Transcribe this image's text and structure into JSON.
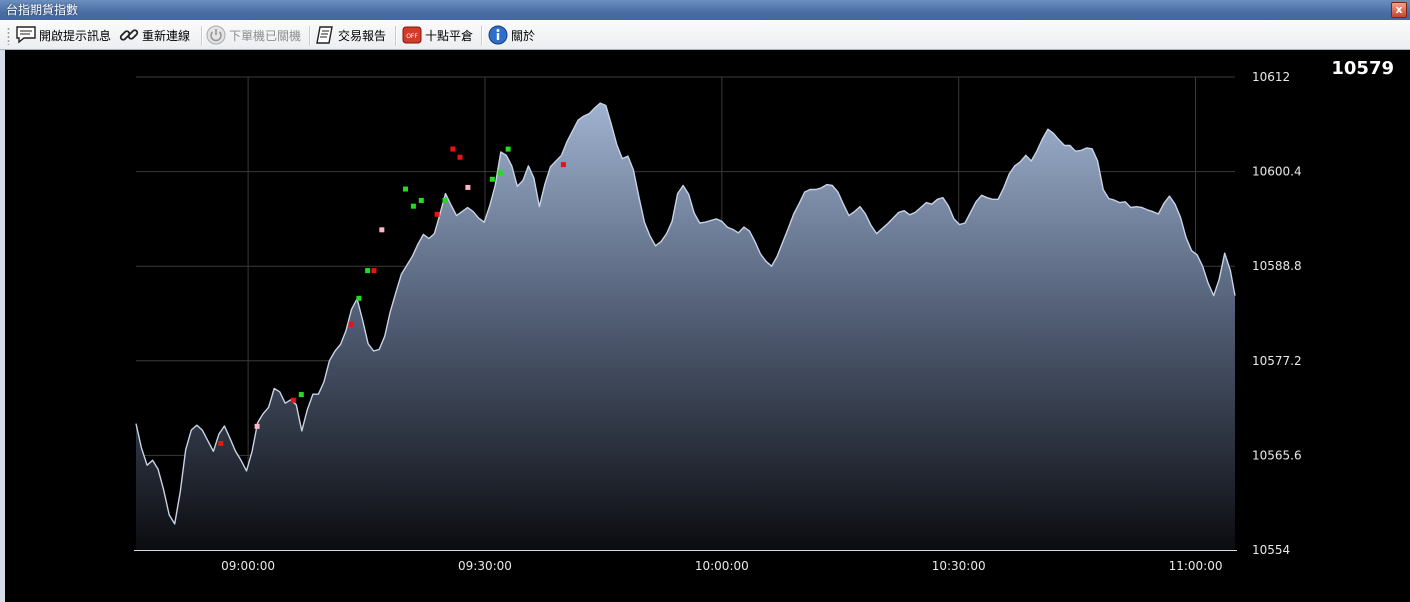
{
  "window": {
    "title": "台指期貨指數",
    "close_label": "x"
  },
  "toolbar": {
    "items": [
      {
        "label": "開啟提示訊息",
        "icon": "message-icon"
      },
      {
        "label": "重新連線",
        "icon": "link-icon"
      },
      {
        "label": "下單機已關機",
        "icon": "power-icon",
        "disabled": true
      },
      {
        "label": "交易報告",
        "icon": "report-icon"
      },
      {
        "label": "十點平倉",
        "icon": "off-icon"
      },
      {
        "label": "關於",
        "icon": "info-icon"
      }
    ]
  },
  "last_price": "10579",
  "colors": {
    "background": "#000000",
    "fill_top": "#9fb2cf",
    "fill_bottom": "#0b0c10",
    "line": "#c7d3e6",
    "grid": "#3a3a3a",
    "buy": "#22dd22",
    "sell": "#ee1111",
    "flat": "#ffb6c1"
  },
  "chart_data": {
    "type": "area",
    "title": "",
    "xlabel": "",
    "ylabel": "",
    "x_tick_labels": [
      "09:00:00",
      "09:30:00",
      "10:00:00",
      "10:30:00",
      "11:00:00"
    ],
    "x_tick_minutes": [
      0,
      30,
      60,
      90,
      120
    ],
    "xlim_minutes": [
      -14.2,
      125
    ],
    "y_tick_labels": [
      "10554",
      "10565.6",
      "10577.2",
      "10588.8",
      "10600.4",
      "10612"
    ],
    "ylim": [
      10554,
      10612
    ],
    "grid": true,
    "y_axis_position": "right",
    "x_minutes": [
      -14.2,
      -13.5,
      -12.8,
      -12.1,
      -11.4,
      -10.7,
      -10,
      -9.3,
      -8.6,
      -7.9,
      -7.2,
      -6.5,
      -5.8,
      -5.1,
      -4.4,
      -3.7,
      -3,
      -2.3,
      -1.6,
      -0.9,
      -0.2,
      0.5,
      1.2,
      1.9,
      2.6,
      3.3,
      4,
      4.7,
      5.4,
      6.1,
      6.8,
      7.5,
      8.2,
      8.9,
      9.6,
      10.3,
      11,
      11.7,
      12.4,
      13.1,
      13.8,
      14.5,
      15.2,
      15.9,
      16.6,
      17.3,
      18,
      18.7,
      19.4,
      20.1,
      20.8,
      21.5,
      22.2,
      22.9,
      23.6,
      24.3,
      25,
      25.7,
      26.4,
      27.1,
      27.8,
      28.5,
      29.2,
      29.9,
      30.6,
      31.3,
      32,
      32.7,
      33.4,
      34.1,
      34.8,
      35.5,
      36.2,
      36.9,
      37.6,
      38.3,
      39,
      39.7,
      40.4,
      41.1,
      41.8,
      42.5,
      43.2,
      43.9,
      44.6,
      45.3,
      46,
      46.7,
      47.4,
      48.1,
      48.8,
      49.5,
      50.2,
      50.9,
      51.6,
      52.3,
      53,
      53.7,
      54.4,
      55.1,
      55.8,
      56.5,
      57.2,
      57.9,
      58.6,
      59.3,
      60,
      60.7,
      61.4,
      62.1,
      62.8,
      63.5,
      64.2,
      64.9,
      65.6,
      66.3,
      67,
      67.7,
      68.4,
      69.1,
      69.8,
      70.5,
      71.2,
      71.9,
      72.6,
      73.3,
      74,
      74.7,
      75.4,
      76.1,
      76.8,
      77.5,
      78.2,
      78.9,
      79.6,
      80.3,
      81,
      81.7,
      82.4,
      83.1,
      83.8,
      84.5,
      85.2,
      85.9,
      86.6,
      87.3,
      88,
      88.7,
      89.4,
      90.1,
      90.8,
      91.5,
      92.2,
      92.9,
      93.6,
      94.3,
      95,
      95.7,
      96.4,
      97.1,
      97.8,
      98.5,
      99.2,
      99.9,
      100.6,
      101.3,
      102,
      102.7,
      103.4,
      104.1,
      104.8,
      105.5,
      106.2,
      106.9,
      107.6,
      108.3,
      109,
      109.7,
      110.4,
      111.1,
      111.8,
      112.5,
      113.2,
      113.9,
      114.6,
      115.3,
      116,
      116.7,
      117.4,
      118.1,
      118.8,
      119.5,
      120.2,
      120.9,
      121.6,
      122.3,
      123,
      123.7,
      124.4,
      125
    ],
    "y_values": [
      10569.5,
      10566.5,
      10564.4,
      10565,
      10563.9,
      10561.4,
      10558.3,
      10557.2,
      10561.1,
      10566.3,
      10568.7,
      10569.3,
      10568.7,
      10567.4,
      10566.1,
      10568.2,
      10569.2,
      10567.7,
      10566.1,
      10565,
      10563.7,
      10566.1,
      10569.6,
      10570.7,
      10571.5,
      10573.8,
      10573.4,
      10572,
      10572.4,
      10571.8,
      10568.6,
      10571.2,
      10573.1,
      10573.1,
      10574.6,
      10577.2,
      10578.4,
      10579.2,
      10580.9,
      10583.5,
      10584.8,
      10582.2,
      10579.3,
      10578.4,
      10578.6,
      10580.2,
      10583.2,
      10585.5,
      10587.8,
      10588.9,
      10590,
      10591.5,
      10592.7,
      10592.2,
      10592.8,
      10595.2,
      10597.7,
      10596.3,
      10595,
      10595.5,
      10596,
      10595.5,
      10594.7,
      10594.2,
      10596.2,
      10598.7,
      10602.8,
      10602.4,
      10601.1,
      10598.6,
      10599.3,
      10601.1,
      10599.6,
      10596.1,
      10598.9,
      10601,
      10601.7,
      10602.4,
      10604.1,
      10605.4,
      10606.7,
      10607.2,
      10607.5,
      10608.2,
      10608.8,
      10608.5,
      10606.2,
      10603.7,
      10602,
      10602.3,
      10600.6,
      10597.3,
      10594.2,
      10592.5,
      10591.3,
      10591.8,
      10592.8,
      10594.3,
      10597.7,
      10598.7,
      10597.6,
      10595.3,
      10594.1,
      10594.2,
      10594.4,
      10594.6,
      10594.3,
      10593.6,
      10593.3,
      10592.9,
      10593.6,
      10593.1,
      10591.8,
      10590.3,
      10589.4,
      10588.8,
      10590,
      10591.7,
      10593.4,
      10595.2,
      10596.5,
      10597.9,
      10598.2,
      10598.2,
      10598.4,
      10598.8,
      10598.7,
      10597.9,
      10596.4,
      10595,
      10595.5,
      10596.1,
      10595.2,
      10593.8,
      10592.8,
      10593.4,
      10594,
      10594.7,
      10595.4,
      10595.6,
      10595.1,
      10595.4,
      10596,
      10596.6,
      10596.4,
      10597,
      10597.2,
      10596.2,
      10594.6,
      10593.9,
      10594.1,
      10595.4,
      10596.7,
      10597.5,
      10597.2,
      10597,
      10597,
      10598.4,
      10600.1,
      10601.1,
      10601.6,
      10602.4,
      10601.7,
      10602.9,
      10604.4,
      10605.6,
      10605.1,
      10604.3,
      10603.6,
      10603.6,
      10602.9,
      10603,
      10603.3,
      10603.2,
      10601.7,
      10598.2,
      10597.1,
      10596.9,
      10596.6,
      10596.7,
      10596,
      10596.1,
      10596,
      10595.7,
      10595.5,
      10595.2,
      10596.5,
      10597.4,
      10596.4,
      10594.8,
      10592.3,
      10590.7,
      10590.2,
      10588.8,
      10586.7,
      10585.2,
      10587.2,
      10590.4,
      10588.3,
      10585.2,
      10582.9,
      10582.1,
      10585.6,
      10587.5,
      10588.4,
      10588.9,
      10588.6,
      10587.1,
      10587.4,
      10586.8,
      10586.1,
      10586.6,
      10586.6,
      10586.6,
      10586.5,
      10586.4,
      10586.2,
      10586.9,
      10587.9,
      10587.8,
      10587.6,
      10587.6,
      10587.4,
      10587,
      10586.6,
      10586.1,
      10585.9,
      10585.2,
      10584.6,
      10584.8,
      10585.9,
      10586.2,
      10584.2,
      10581.5,
      10580.9,
      10579.6,
      10579.1,
      10580.5,
      10580.8,
      10580.9,
      10580.8,
      10580.4
    ],
    "trade_markers": [
      {
        "time_min": 1.2,
        "price": 10569.1,
        "type": "flat"
      },
      {
        "time_min": -3.4,
        "price": 10567.0,
        "type": "sell"
      },
      {
        "time_min": 5.8,
        "price": 10572.3,
        "type": "sell"
      },
      {
        "time_min": 6.8,
        "price": 10573.0,
        "type": "buy"
      },
      {
        "time_min": 13.1,
        "price": 10581.6,
        "type": "sell"
      },
      {
        "time_min": 14.1,
        "price": 10584.8,
        "type": "buy"
      },
      {
        "time_min": 15.2,
        "price": 10588.2,
        "type": "buy"
      },
      {
        "time_min": 16.0,
        "price": 10588.2,
        "type": "sell"
      },
      {
        "time_min": 17.0,
        "price": 10593.2,
        "type": "flat"
      },
      {
        "time_min": 20.0,
        "price": 10598.2,
        "type": "buy"
      },
      {
        "time_min": 21.0,
        "price": 10596.1,
        "type": "buy"
      },
      {
        "time_min": 22.0,
        "price": 10596.8,
        "type": "buy"
      },
      {
        "time_min": 24.0,
        "price": 10595.1,
        "type": "sell"
      },
      {
        "time_min": 25.0,
        "price": 10596.8,
        "type": "buy"
      },
      {
        "time_min": 26.0,
        "price": 10603.1,
        "type": "sell"
      },
      {
        "time_min": 26.9,
        "price": 10602.1,
        "type": "sell"
      },
      {
        "time_min": 27.9,
        "price": 10598.4,
        "type": "flat"
      },
      {
        "time_min": 31.0,
        "price": 10599.4,
        "type": "buy"
      },
      {
        "time_min": 32.0,
        "price": 10600.2,
        "type": "buy"
      },
      {
        "time_min": 33.0,
        "price": 10603.1,
        "type": "buy"
      },
      {
        "time_min": 40.0,
        "price": 10601.2,
        "type": "sell"
      }
    ]
  }
}
